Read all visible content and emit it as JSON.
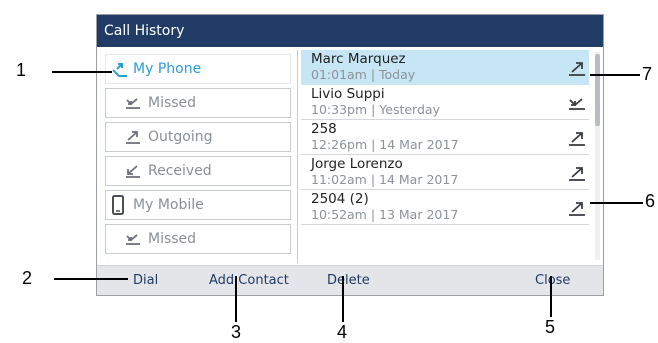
{
  "window": {
    "title": "Call History"
  },
  "left_menu": {
    "items": [
      {
        "label": "My Phone",
        "icon": "phone-call-log-icon",
        "selected": true
      },
      {
        "label": "Missed",
        "icon": "missed-call-icon",
        "selected": false
      },
      {
        "label": "Outgoing",
        "icon": "outgoing-call-icon",
        "selected": false
      },
      {
        "label": "Received",
        "icon": "received-call-icon",
        "selected": false
      },
      {
        "label": "My Mobile",
        "icon": "mobile-phone-icon",
        "selected": false
      },
      {
        "label": "Missed",
        "icon": "missed-call-icon",
        "selected": false
      }
    ]
  },
  "calls": [
    {
      "name": "Marc Marquez",
      "when": "01:01am | Today",
      "direction": "outgoing",
      "selected": true
    },
    {
      "name": "Livio Suppi",
      "when": "10:33pm | Yesterday",
      "direction": "missed",
      "selected": false
    },
    {
      "name": "258",
      "when": "12:26pm | 14 Mar 2017",
      "direction": "outgoing",
      "selected": false
    },
    {
      "name": "Jorge Lorenzo",
      "when": "11:02am | 14 Mar 2017",
      "direction": "outgoing",
      "selected": false
    },
    {
      "name": "2504 (2)",
      "when": "10:52am | 13 Mar 2017",
      "direction": "outgoing",
      "selected": false
    }
  ],
  "softkeys": {
    "dial": "Dial",
    "add_contact": "Add Contact",
    "delete": "Delete",
    "close": "Close"
  },
  "callouts": [
    "1",
    "2",
    "3",
    "4",
    "5",
    "6",
    "7"
  ],
  "colors": {
    "title_bar": "#1f3b66",
    "selected_text": "#2c9cd6",
    "selected_row": "#c6e6f5",
    "softkey_bar": "#e3e5e8"
  }
}
